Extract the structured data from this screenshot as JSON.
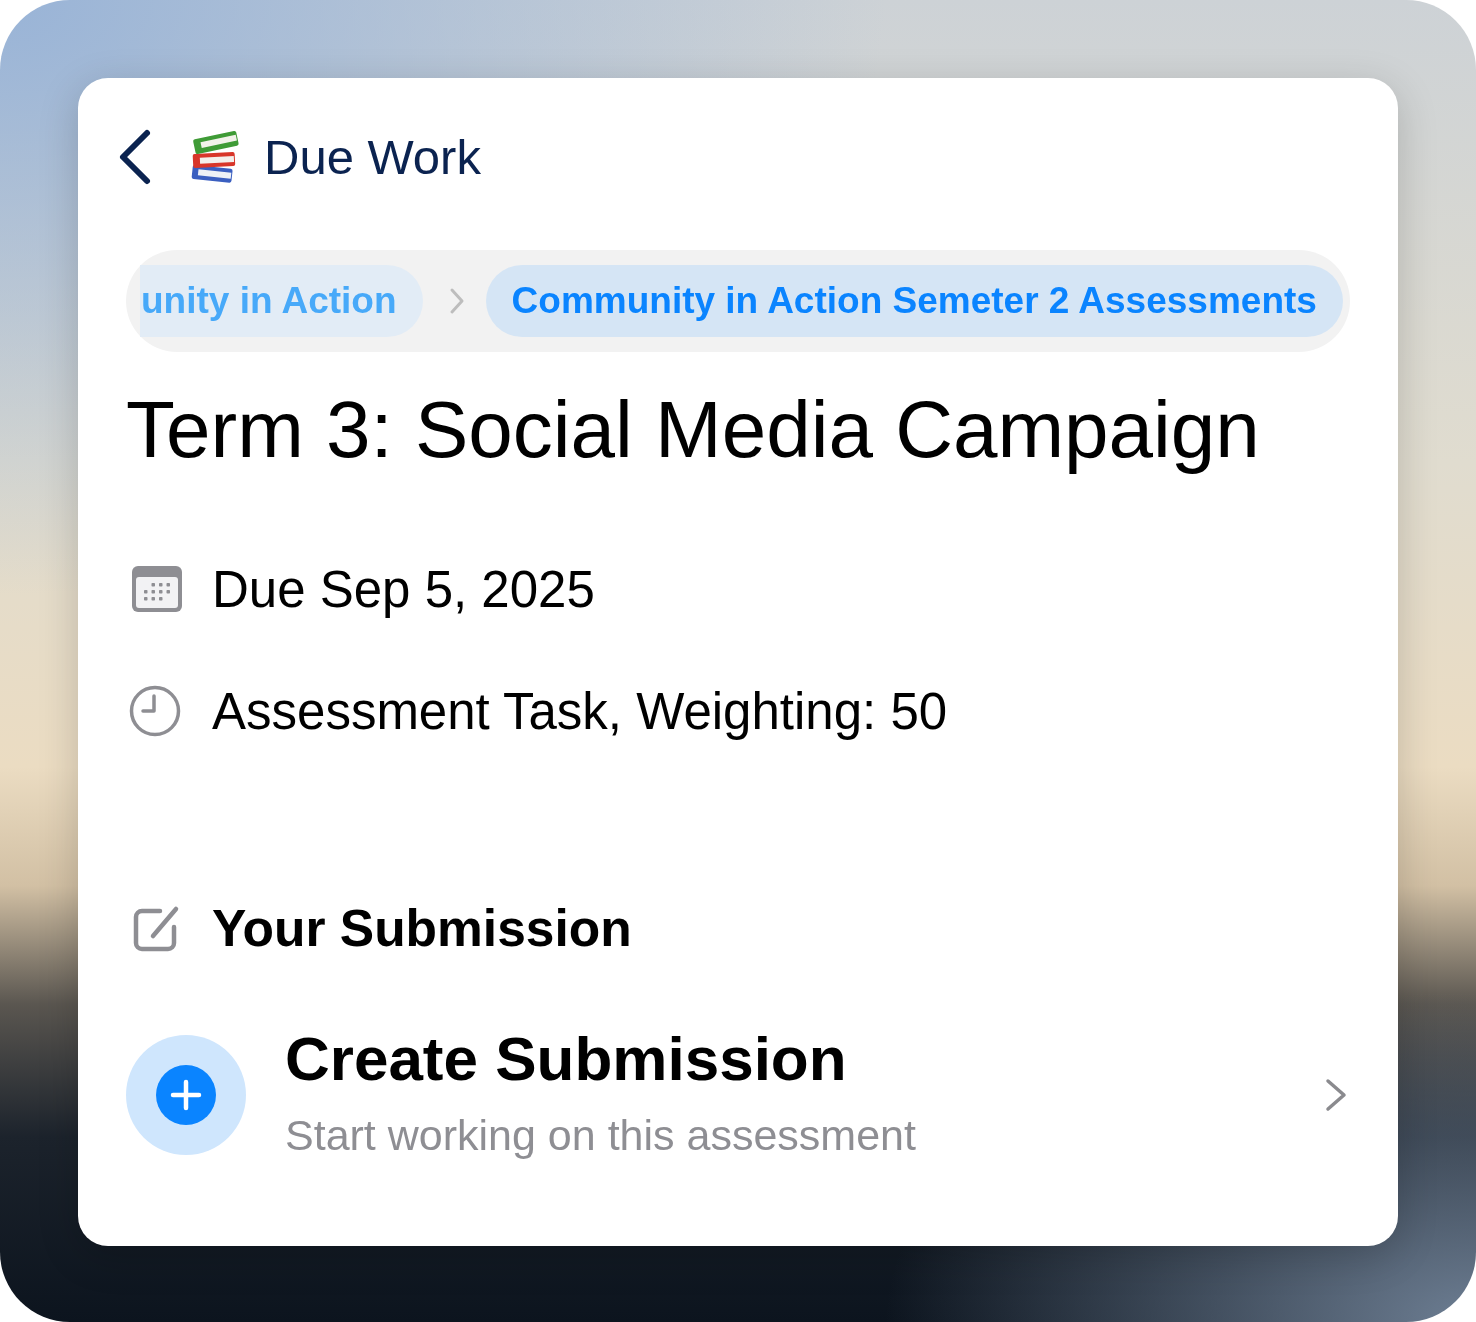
{
  "header": {
    "title": "Due Work"
  },
  "breadcrumbs": [
    {
      "label": "unity in Action",
      "selected": false
    },
    {
      "label": "Community in Action Semeter 2 Assessments",
      "selected": true
    }
  ],
  "assignment": {
    "title": "Term 3: Social Media Campaign",
    "details": [
      {
        "kind": "due",
        "text": "Due Sep 5, 2025"
      },
      {
        "kind": "task",
        "text": "Assessment Task, Weighting: 50"
      }
    ]
  },
  "submission": {
    "heading": "Your Submission",
    "action": {
      "title": "Create Submission",
      "subtitle": "Start working on this assessment"
    }
  }
}
